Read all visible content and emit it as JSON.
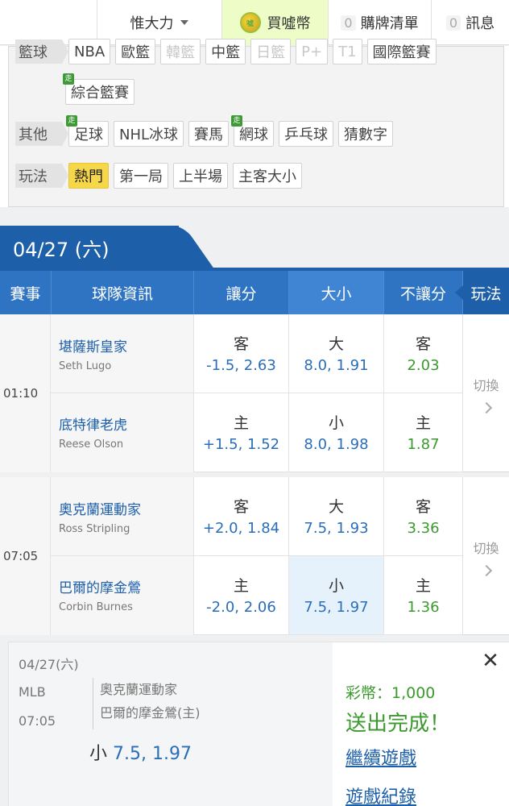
{
  "nav": {
    "user": "惟大力",
    "buy_coin": "買噓幣",
    "coin_icon_text": "噓",
    "cart_count": "0",
    "cart_label": "購牌清單",
    "msg_count": "0",
    "msg_label": "訊息"
  },
  "filters": {
    "basketball": {
      "label": "籃球",
      "items": [
        {
          "label": "NBA",
          "state": "normal"
        },
        {
          "label": "歐籃",
          "state": "normal"
        },
        {
          "label": "韓籃",
          "state": "dim"
        },
        {
          "label": "中籃",
          "state": "normal"
        },
        {
          "label": "日籃",
          "state": "dim"
        },
        {
          "label": "P+",
          "state": "dim"
        },
        {
          "label": "T1",
          "state": "dim"
        },
        {
          "label": "國際籃賽",
          "state": "normal"
        },
        {
          "label": "綜合籃賽",
          "state": "normal",
          "badge": "走"
        }
      ]
    },
    "other": {
      "label": "其他",
      "items": [
        {
          "label": "足球",
          "badge": "走"
        },
        {
          "label": "NHL冰球"
        },
        {
          "label": "賽馬"
        },
        {
          "label": "網球",
          "badge": "走"
        },
        {
          "label": "乒乓球"
        },
        {
          "label": "猜數字"
        }
      ]
    },
    "play": {
      "label": "玩法",
      "items": [
        {
          "label": "熱門",
          "active": true
        },
        {
          "label": "第一局"
        },
        {
          "label": "上半場"
        },
        {
          "label": "主客大小"
        }
      ]
    }
  },
  "date_tab": "04/27 (六)",
  "table_headers": {
    "event": "賽事",
    "team": "球隊資訊",
    "spread": "讓分",
    "total": "大小",
    "moneyline": "不讓分",
    "play": "玩法"
  },
  "games": [
    {
      "time": "01:10",
      "switch": "切換",
      "away": {
        "team": "堪薩斯皇家",
        "pitcher": "Seth Lugo",
        "spread_side": "客",
        "spread": "-1.5, 2.63",
        "total_side": "大",
        "total": "8.0, 1.91",
        "ml_side": "客",
        "ml": "2.03"
      },
      "home": {
        "team": "底特律老虎",
        "pitcher": "Reese Olson",
        "spread_side": "主",
        "spread": "+1.5, 1.52",
        "total_side": "小",
        "total": "8.0, 1.98",
        "ml_side": "主",
        "ml": "1.87"
      }
    },
    {
      "time": "07:05",
      "switch": "切換",
      "away": {
        "team": "奧克蘭運動家",
        "pitcher": "Ross Stripling",
        "spread_side": "客",
        "spread": "+2.0, 1.84",
        "total_side": "大",
        "total": "7.5, 1.93",
        "ml_side": "客",
        "ml": "3.36"
      },
      "home": {
        "team": "巴爾的摩金鶯",
        "pitcher": "Corbin Burnes",
        "spread_side": "主",
        "spread": "-2.0, 2.06",
        "total_side": "小",
        "total": "7.5, 1.97",
        "ml_side": "主",
        "ml": "1.36"
      }
    }
  ],
  "slip": {
    "date": "04/27(六)",
    "league": "MLB",
    "time": "07:05",
    "team1": "奧克蘭運動家",
    "team2": "巴爾的摩金鶯(主)",
    "pick_side": "小",
    "pick_odds": "7.5, 1.97",
    "coins": "彩幣：1,000",
    "done": "送出完成！",
    "continue": "繼續遊戲",
    "history": "遊戲紀錄",
    "close": "✕"
  }
}
